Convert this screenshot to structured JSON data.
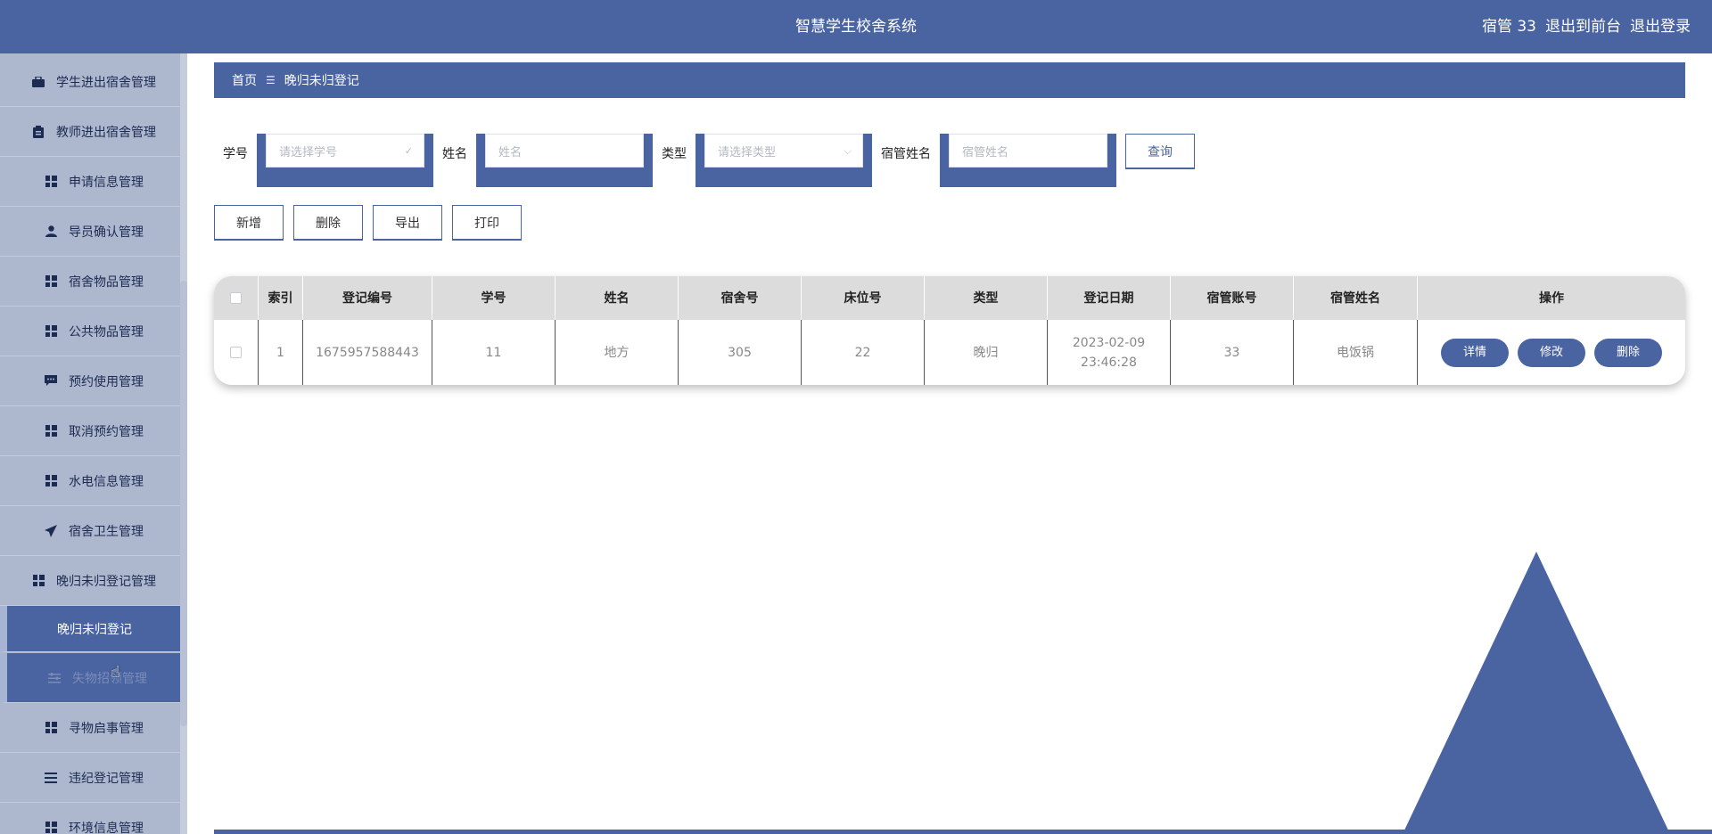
{
  "header": {
    "title": "智慧学生校舍系统",
    "user": "宿管 33",
    "exit_front": "退出到前台",
    "logout": "退出登录"
  },
  "sidebar": {
    "items": [
      {
        "label": "学生进出宿舍管理",
        "icon": "briefcase-icon"
      },
      {
        "label": "教师进出宿舍管理",
        "icon": "clipboard-icon"
      },
      {
        "label": "申请信息管理",
        "icon": "grid-icon"
      },
      {
        "label": "导员确认管理",
        "icon": "user-icon"
      },
      {
        "label": "宿舍物品管理",
        "icon": "grid-icon"
      },
      {
        "label": "公共物品管理",
        "icon": "grid-icon"
      },
      {
        "label": "预约使用管理",
        "icon": "comment-icon"
      },
      {
        "label": "取消预约管理",
        "icon": "grid-icon"
      },
      {
        "label": "水电信息管理",
        "icon": "grid-icon"
      },
      {
        "label": "宿舍卫生管理",
        "icon": "paper-plane-icon"
      },
      {
        "label": "晚归未归登记管理",
        "icon": "grid-icon"
      },
      {
        "label": "晚归未归登记",
        "icon": ""
      },
      {
        "label": "失物招领管理",
        "icon": "sliders-icon"
      },
      {
        "label": "寻物启事管理",
        "icon": "grid-icon"
      },
      {
        "label": "违纪登记管理",
        "icon": "list-icon"
      },
      {
        "label": "环境信息管理",
        "icon": "grid-icon"
      }
    ]
  },
  "breadcrumb": {
    "home": "首页",
    "separator": "☰",
    "current": "晚归未归登记"
  },
  "filters": {
    "student_no_label": "学号",
    "student_no_placeholder": "请选择学号",
    "name_label": "姓名",
    "name_placeholder": "姓名",
    "type_label": "类型",
    "type_placeholder": "请选择类型",
    "manager_name_label": "宿管姓名",
    "manager_name_placeholder": "宿管姓名",
    "query_button": "查询"
  },
  "actions": {
    "add": "新增",
    "delete": "删除",
    "export": "导出",
    "print": "打印"
  },
  "table": {
    "headers": [
      "索引",
      "登记编号",
      "学号",
      "姓名",
      "宿舍号",
      "床位号",
      "类型",
      "登记日期",
      "宿管账号",
      "宿管姓名",
      "操作"
    ],
    "rows": [
      {
        "index": "1",
        "reg_no": "1675957588443",
        "student_no": "11",
        "name": "地方",
        "dorm_no": "305",
        "bed_no": "22",
        "type": "晚归",
        "date": "2023-02-09 23:46:28",
        "manager_account": "33",
        "manager_name": "电饭锅",
        "btn_detail": "详情",
        "btn_edit": "修改",
        "btn_delete": "删除"
      }
    ]
  },
  "colors": {
    "primary": "#4a64a1",
    "sidebar_bg": "#adb7cd",
    "table_header_bg": "#dcdcdc"
  }
}
